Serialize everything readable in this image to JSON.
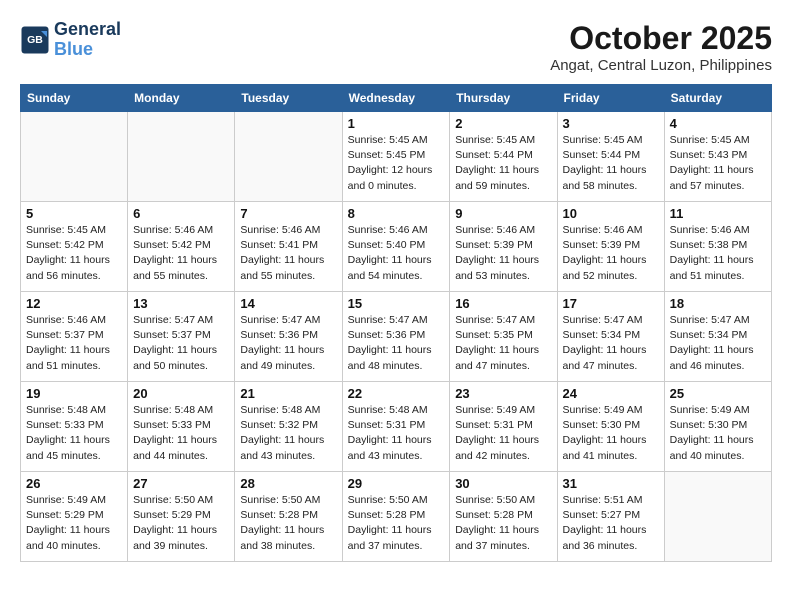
{
  "header": {
    "logo_line1": "General",
    "logo_line2": "Blue",
    "month": "October 2025",
    "location": "Angat, Central Luzon, Philippines"
  },
  "weekdays": [
    "Sunday",
    "Monday",
    "Tuesday",
    "Wednesday",
    "Thursday",
    "Friday",
    "Saturday"
  ],
  "weeks": [
    [
      {
        "day": "",
        "info": ""
      },
      {
        "day": "",
        "info": ""
      },
      {
        "day": "",
        "info": ""
      },
      {
        "day": "1",
        "info": "Sunrise: 5:45 AM\nSunset: 5:45 PM\nDaylight: 12 hours\nand 0 minutes."
      },
      {
        "day": "2",
        "info": "Sunrise: 5:45 AM\nSunset: 5:44 PM\nDaylight: 11 hours\nand 59 minutes."
      },
      {
        "day": "3",
        "info": "Sunrise: 5:45 AM\nSunset: 5:44 PM\nDaylight: 11 hours\nand 58 minutes."
      },
      {
        "day": "4",
        "info": "Sunrise: 5:45 AM\nSunset: 5:43 PM\nDaylight: 11 hours\nand 57 minutes."
      }
    ],
    [
      {
        "day": "5",
        "info": "Sunrise: 5:45 AM\nSunset: 5:42 PM\nDaylight: 11 hours\nand 56 minutes."
      },
      {
        "day": "6",
        "info": "Sunrise: 5:46 AM\nSunset: 5:42 PM\nDaylight: 11 hours\nand 55 minutes."
      },
      {
        "day": "7",
        "info": "Sunrise: 5:46 AM\nSunset: 5:41 PM\nDaylight: 11 hours\nand 55 minutes."
      },
      {
        "day": "8",
        "info": "Sunrise: 5:46 AM\nSunset: 5:40 PM\nDaylight: 11 hours\nand 54 minutes."
      },
      {
        "day": "9",
        "info": "Sunrise: 5:46 AM\nSunset: 5:39 PM\nDaylight: 11 hours\nand 53 minutes."
      },
      {
        "day": "10",
        "info": "Sunrise: 5:46 AM\nSunset: 5:39 PM\nDaylight: 11 hours\nand 52 minutes."
      },
      {
        "day": "11",
        "info": "Sunrise: 5:46 AM\nSunset: 5:38 PM\nDaylight: 11 hours\nand 51 minutes."
      }
    ],
    [
      {
        "day": "12",
        "info": "Sunrise: 5:46 AM\nSunset: 5:37 PM\nDaylight: 11 hours\nand 51 minutes."
      },
      {
        "day": "13",
        "info": "Sunrise: 5:47 AM\nSunset: 5:37 PM\nDaylight: 11 hours\nand 50 minutes."
      },
      {
        "day": "14",
        "info": "Sunrise: 5:47 AM\nSunset: 5:36 PM\nDaylight: 11 hours\nand 49 minutes."
      },
      {
        "day": "15",
        "info": "Sunrise: 5:47 AM\nSunset: 5:36 PM\nDaylight: 11 hours\nand 48 minutes."
      },
      {
        "day": "16",
        "info": "Sunrise: 5:47 AM\nSunset: 5:35 PM\nDaylight: 11 hours\nand 47 minutes."
      },
      {
        "day": "17",
        "info": "Sunrise: 5:47 AM\nSunset: 5:34 PM\nDaylight: 11 hours\nand 47 minutes."
      },
      {
        "day": "18",
        "info": "Sunrise: 5:47 AM\nSunset: 5:34 PM\nDaylight: 11 hours\nand 46 minutes."
      }
    ],
    [
      {
        "day": "19",
        "info": "Sunrise: 5:48 AM\nSunset: 5:33 PM\nDaylight: 11 hours\nand 45 minutes."
      },
      {
        "day": "20",
        "info": "Sunrise: 5:48 AM\nSunset: 5:33 PM\nDaylight: 11 hours\nand 44 minutes."
      },
      {
        "day": "21",
        "info": "Sunrise: 5:48 AM\nSunset: 5:32 PM\nDaylight: 11 hours\nand 43 minutes."
      },
      {
        "day": "22",
        "info": "Sunrise: 5:48 AM\nSunset: 5:31 PM\nDaylight: 11 hours\nand 43 minutes."
      },
      {
        "day": "23",
        "info": "Sunrise: 5:49 AM\nSunset: 5:31 PM\nDaylight: 11 hours\nand 42 minutes."
      },
      {
        "day": "24",
        "info": "Sunrise: 5:49 AM\nSunset: 5:30 PM\nDaylight: 11 hours\nand 41 minutes."
      },
      {
        "day": "25",
        "info": "Sunrise: 5:49 AM\nSunset: 5:30 PM\nDaylight: 11 hours\nand 40 minutes."
      }
    ],
    [
      {
        "day": "26",
        "info": "Sunrise: 5:49 AM\nSunset: 5:29 PM\nDaylight: 11 hours\nand 40 minutes."
      },
      {
        "day": "27",
        "info": "Sunrise: 5:50 AM\nSunset: 5:29 PM\nDaylight: 11 hours\nand 39 minutes."
      },
      {
        "day": "28",
        "info": "Sunrise: 5:50 AM\nSunset: 5:28 PM\nDaylight: 11 hours\nand 38 minutes."
      },
      {
        "day": "29",
        "info": "Sunrise: 5:50 AM\nSunset: 5:28 PM\nDaylight: 11 hours\nand 37 minutes."
      },
      {
        "day": "30",
        "info": "Sunrise: 5:50 AM\nSunset: 5:28 PM\nDaylight: 11 hours\nand 37 minutes."
      },
      {
        "day": "31",
        "info": "Sunrise: 5:51 AM\nSunset: 5:27 PM\nDaylight: 11 hours\nand 36 minutes."
      },
      {
        "day": "",
        "info": ""
      }
    ]
  ]
}
